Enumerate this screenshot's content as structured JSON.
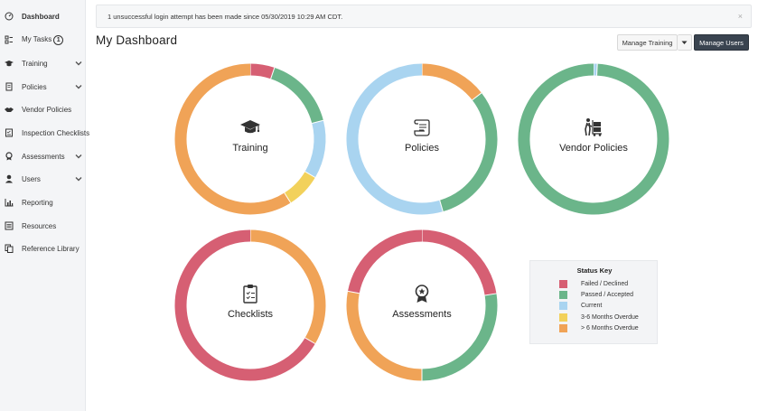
{
  "sidebar": {
    "items": [
      {
        "label": "Dashboard",
        "icon": "dashboard-icon",
        "active": true
      },
      {
        "label": "My Tasks",
        "icon": "tasks-icon",
        "badge": "1"
      },
      {
        "label": "Training",
        "icon": "graduation-cap-icon",
        "expandable": true
      },
      {
        "label": "Policies",
        "icon": "document-icon",
        "expandable": true
      },
      {
        "label": "Vendor Policies",
        "icon": "handshake-icon"
      },
      {
        "label": "Inspection Checklists",
        "icon": "checklist-icon"
      },
      {
        "label": "Assessments",
        "icon": "award-icon",
        "expandable": true
      },
      {
        "label": "Users",
        "icon": "user-icon",
        "expandable": true
      },
      {
        "label": "Reporting",
        "icon": "bar-chart-icon"
      },
      {
        "label": "Resources",
        "icon": "list-icon"
      },
      {
        "label": "Reference Library",
        "icon": "copy-icon"
      }
    ]
  },
  "alert": {
    "message": "1 unsuccessful login attempt has been made since 05/30/2019 10:29 AM CDT.",
    "close": "×"
  },
  "header": {
    "title": "My Dashboard",
    "manage_training": "Manage Training",
    "manage_users": "Manage Users"
  },
  "colors": {
    "failed": "#d65f73",
    "passed": "#6bb58a",
    "current": "#a9d4f0",
    "months_3_6": "#f2d15b",
    "months_6_plus": "#f0a357"
  },
  "donuts": [
    {
      "label": "Training",
      "icon": "graduation-cap-icon",
      "segments": [
        {
          "status": "failed",
          "pct": 5.2
        },
        {
          "status": "passed",
          "pct": 15.8
        },
        {
          "status": "current",
          "pct": 12.5
        },
        {
          "status": "months_3_6",
          "pct": 7.5
        },
        {
          "status": "months_6_plus",
          "pct": 59.0
        }
      ]
    },
    {
      "label": "Policies",
      "icon": "scroll-icon",
      "segments": [
        {
          "status": "months_6_plus",
          "pct": 14.5
        },
        {
          "status": "passed",
          "pct": 31.0
        },
        {
          "status": "current",
          "pct": 54.5
        }
      ]
    },
    {
      "label": "Vendor Policies",
      "icon": "hand-truck-icon",
      "segments": [
        {
          "status": "current",
          "pct": 0.8
        },
        {
          "status": "passed",
          "pct": 99.2
        }
      ]
    },
    {
      "label": "Checklists",
      "icon": "clipboard-icon",
      "segments": [
        {
          "status": "months_6_plus",
          "pct": 33.5
        },
        {
          "status": "failed",
          "pct": 66.5
        }
      ]
    },
    {
      "label": "Assessments",
      "icon": "award-icon",
      "segments": [
        {
          "status": "failed",
          "pct": 22.5
        },
        {
          "status": "passed",
          "pct": 27.5
        },
        {
          "status": "months_6_plus",
          "pct": 28.0
        },
        {
          "status": "failed",
          "pct": 22.0
        }
      ]
    }
  ],
  "status_key": {
    "title": "Status Key",
    "items": [
      {
        "label": "Failed / Declined",
        "status": "failed"
      },
      {
        "label": "Passed / Accepted",
        "status": "passed"
      },
      {
        "label": "Current",
        "status": "current"
      },
      {
        "label": "3-6 Months Overdue",
        "status": "months_3_6"
      },
      {
        "label": "> 6 Months Overdue",
        "status": "months_6_plus"
      }
    ]
  }
}
